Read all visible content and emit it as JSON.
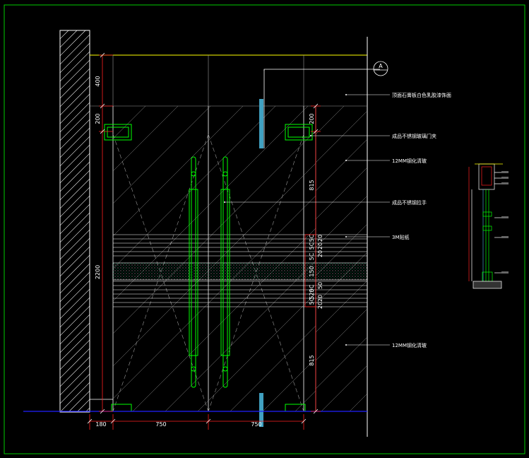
{
  "colors": {
    "background": "#000000",
    "border": "#00cc00",
    "outline": "#ffffff",
    "glass_hatch": "#9a9a9a",
    "dimension": "#ff2020",
    "ceiling": "#ffff00",
    "floor": "#2020ff",
    "hardware": "#00ff00",
    "patch": "#40a0c0"
  },
  "section_marker": "A",
  "dimensions": {
    "vertical_left": [
      "400",
      "200",
      "2200"
    ],
    "vertical_right": [
      "200",
      "815",
      "20",
      "20",
      "20",
      "5C",
      "5C",
      "5C",
      "150",
      "5C",
      "50",
      "5C",
      "520",
      "20",
      "20",
      "815"
    ],
    "horizontal": [
      "180",
      "750",
      "750"
    ]
  },
  "annotations": [
    "顶面石膏板白色乳胶漆饰面",
    "成品不锈钢玻璃门夹",
    "12MM钢化清玻",
    "成品不锈钢拉手",
    "3M贴纸",
    "12MM钢化清玻"
  ]
}
